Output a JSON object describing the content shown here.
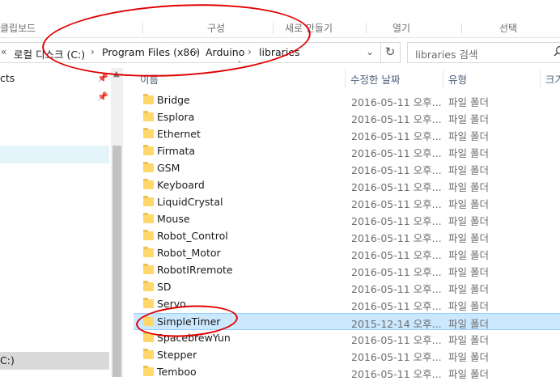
{
  "ribbon": {
    "labels": [
      "클립보드",
      "구성",
      "새로 만들기",
      "열기",
      "선택"
    ]
  },
  "address_bar": {
    "overflow": "«",
    "crumbs": [
      "로컬 디스크 (C:)",
      "Program Files (x86)",
      "Arduino",
      "libraries"
    ],
    "separator": "›",
    "dropdown": "⌄",
    "refresh": "↻"
  },
  "search": {
    "placeholder": "libraries 검색",
    "icon": "search-icon"
  },
  "nav_pane": {
    "items": [
      {
        "label": "cts",
        "pinned": true
      },
      {
        "label": "",
        "pinned": true
      }
    ],
    "bottom_label": "C:)"
  },
  "columns": {
    "name": "이름",
    "date": "수정한 날짜",
    "type": "유형",
    "size": "크기"
  },
  "rows": [
    {
      "name": "Bridge",
      "date": "2016-05-11 오후...",
      "type": "파일 폴더",
      "selected": false
    },
    {
      "name": "Esplora",
      "date": "2016-05-11 오후...",
      "type": "파일 폴더",
      "selected": false
    },
    {
      "name": "Ethernet",
      "date": "2016-05-11 오후...",
      "type": "파일 폴더",
      "selected": false
    },
    {
      "name": "Firmata",
      "date": "2016-05-11 오후...",
      "type": "파일 폴더",
      "selected": false
    },
    {
      "name": "GSM",
      "date": "2016-05-11 오후...",
      "type": "파일 폴더",
      "selected": false
    },
    {
      "name": "Keyboard",
      "date": "2016-05-11 오후...",
      "type": "파일 폴더",
      "selected": false
    },
    {
      "name": "LiquidCrystal",
      "date": "2016-05-11 오후...",
      "type": "파일 폴더",
      "selected": false
    },
    {
      "name": "Mouse",
      "date": "2016-05-11 오후...",
      "type": "파일 폴더",
      "selected": false
    },
    {
      "name": "Robot_Control",
      "date": "2016-05-11 오후...",
      "type": "파일 폴더",
      "selected": false
    },
    {
      "name": "Robot_Motor",
      "date": "2016-05-11 오후...",
      "type": "파일 폴더",
      "selected": false
    },
    {
      "name": "RobotIRremote",
      "date": "2016-05-11 오후...",
      "type": "파일 폴더",
      "selected": false
    },
    {
      "name": "SD",
      "date": "2016-05-11 오후...",
      "type": "파일 폴더",
      "selected": false
    },
    {
      "name": "Servo",
      "date": "2016-05-11 오후...",
      "type": "파일 폴더",
      "selected": false
    },
    {
      "name": "SimpleTimer",
      "date": "2015-12-14 오후...",
      "type": "파일 폴더",
      "selected": true
    },
    {
      "name": "SpacebrewYun",
      "date": "2016-05-11 오후...",
      "type": "파일 폴더",
      "selected": false
    },
    {
      "name": "Stepper",
      "date": "2016-05-11 오후...",
      "type": "파일 폴더",
      "selected": false
    },
    {
      "name": "Temboo",
      "date": "2016-05-11 오후...",
      "type": "파일 폴더",
      "selected": false
    }
  ],
  "colors": {
    "selection": "#cce8ff",
    "annotation": "#e00000",
    "folder": "#ffd76b"
  }
}
